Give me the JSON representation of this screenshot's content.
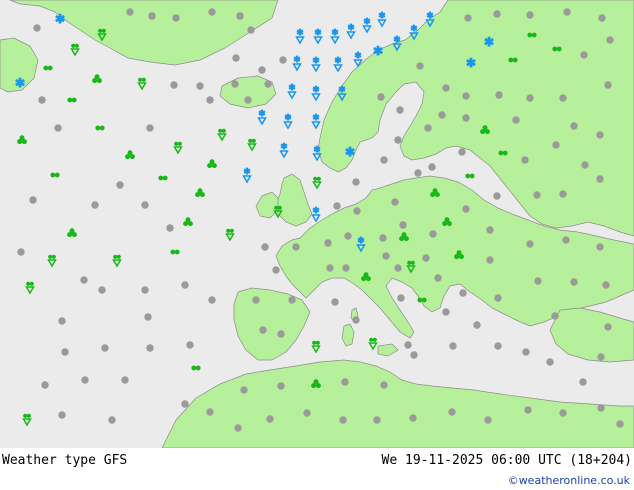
{
  "map": {
    "colors": {
      "sea": "#ebebeb",
      "land": "#b6f09a",
      "coast": "#8c8c8c",
      "dot": "#9a9a9a",
      "rain": "#17b817",
      "snow": "#1a96f0"
    },
    "legend_symbols": [
      {
        "name": "dot-icon"
      },
      {
        "name": "rain-shower-icon"
      },
      {
        "name": "snow-icon"
      },
      {
        "name": "snow-shower-icon"
      },
      {
        "name": "drizzle-icon"
      },
      {
        "name": "thunder-icon"
      }
    ]
  },
  "footer": {
    "title": "Weather type  GFS",
    "timestamp": "We 19-11-2025 06:00 UTC (18+204)",
    "credit": "©weatheronline.co.uk"
  }
}
